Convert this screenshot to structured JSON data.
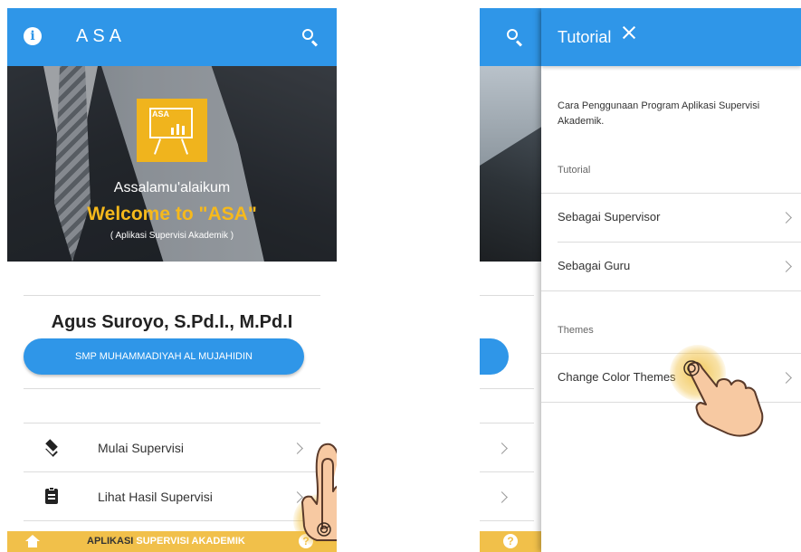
{
  "left": {
    "app_title": "ASA",
    "hero": {
      "logo_text": "ASA",
      "greeting": "Assalamu'alaikum",
      "welcome": "Welcome to \"ASA\"",
      "subtitle": "( Aplikasi Supervisi Akademik )"
    },
    "user_name": "Agus Suroyo, S.Pd.I., M.Pd.I",
    "school": "SMP MUHAMMADIYAH AL MUJAHIDIN",
    "menu": [
      {
        "label": "Mulai Supervisi",
        "icon": "layers-icon"
      },
      {
        "label": "Lihat Hasil Supervisi",
        "icon": "clipboard-icon"
      }
    ],
    "footer": {
      "part1": "APLIKASI ",
      "part2": "SUPERVISI AKADEMIK"
    }
  },
  "drawer": {
    "title": "Tutorial",
    "description": "Cara Penggunaan Program Aplikasi Supervisi Akademik.",
    "tutorial_section": "Tutorial",
    "tutorial_items": [
      "Sebagai Supervisor",
      "Sebagai Guru"
    ],
    "themes_section": "Themes",
    "themes_items": [
      "Change Color Themes"
    ]
  },
  "colors": {
    "primary": "#2f96e8",
    "accent": "#f6b91c",
    "footer": "#f1c04a"
  }
}
